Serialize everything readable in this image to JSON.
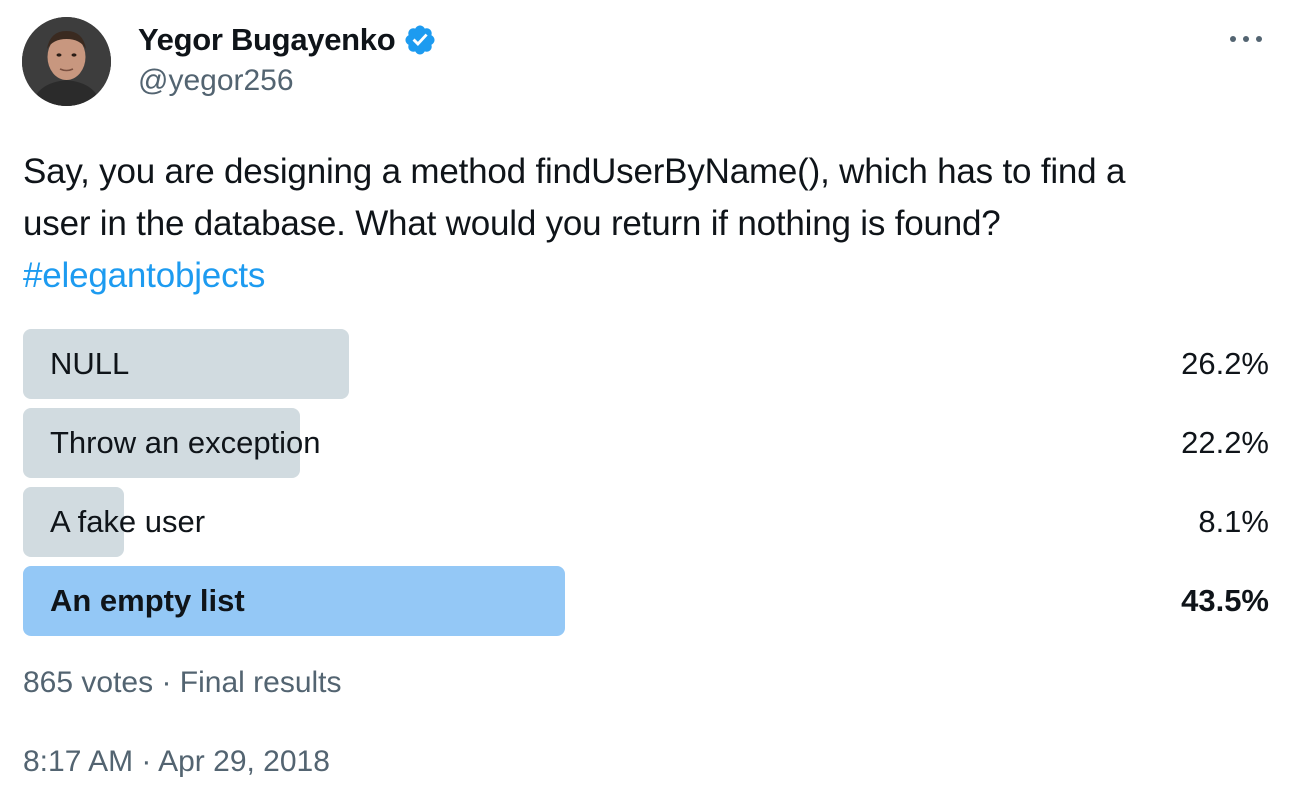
{
  "author": {
    "name": "Yegor Bugayenko",
    "handle": "@yegor256",
    "verified": true
  },
  "tweet": {
    "text_line1": "Say, you are designing a method findUserByName(), which has to find a",
    "text_line2": "user in the database. What would you return if nothing is found?",
    "hashtag": "#elegantobjects"
  },
  "poll": {
    "options": [
      {
        "label": "NULL",
        "percent": "26.2%",
        "value": 26.2,
        "winner": false
      },
      {
        "label": "Throw an exception",
        "percent": "22.2%",
        "value": 22.2,
        "winner": false
      },
      {
        "label": "A fake user",
        "percent": "8.1%",
        "value": 8.1,
        "winner": false
      },
      {
        "label": "An empty list",
        "percent": "43.5%",
        "value": 43.5,
        "winner": true
      }
    ],
    "votes": "865 votes",
    "separator": "·",
    "status": "Final results"
  },
  "meta": {
    "time": "8:17 AM",
    "separator": "·",
    "date": "Apr 29, 2018"
  },
  "colors": {
    "bar": "#cfd9de",
    "winner_bar": "#8ec5f5",
    "link": "#1d9bf0",
    "muted": "#536471",
    "verified": "#1d9bf0"
  },
  "icons": {
    "verified": "verified-badge-icon",
    "more": "more-dots-icon"
  }
}
